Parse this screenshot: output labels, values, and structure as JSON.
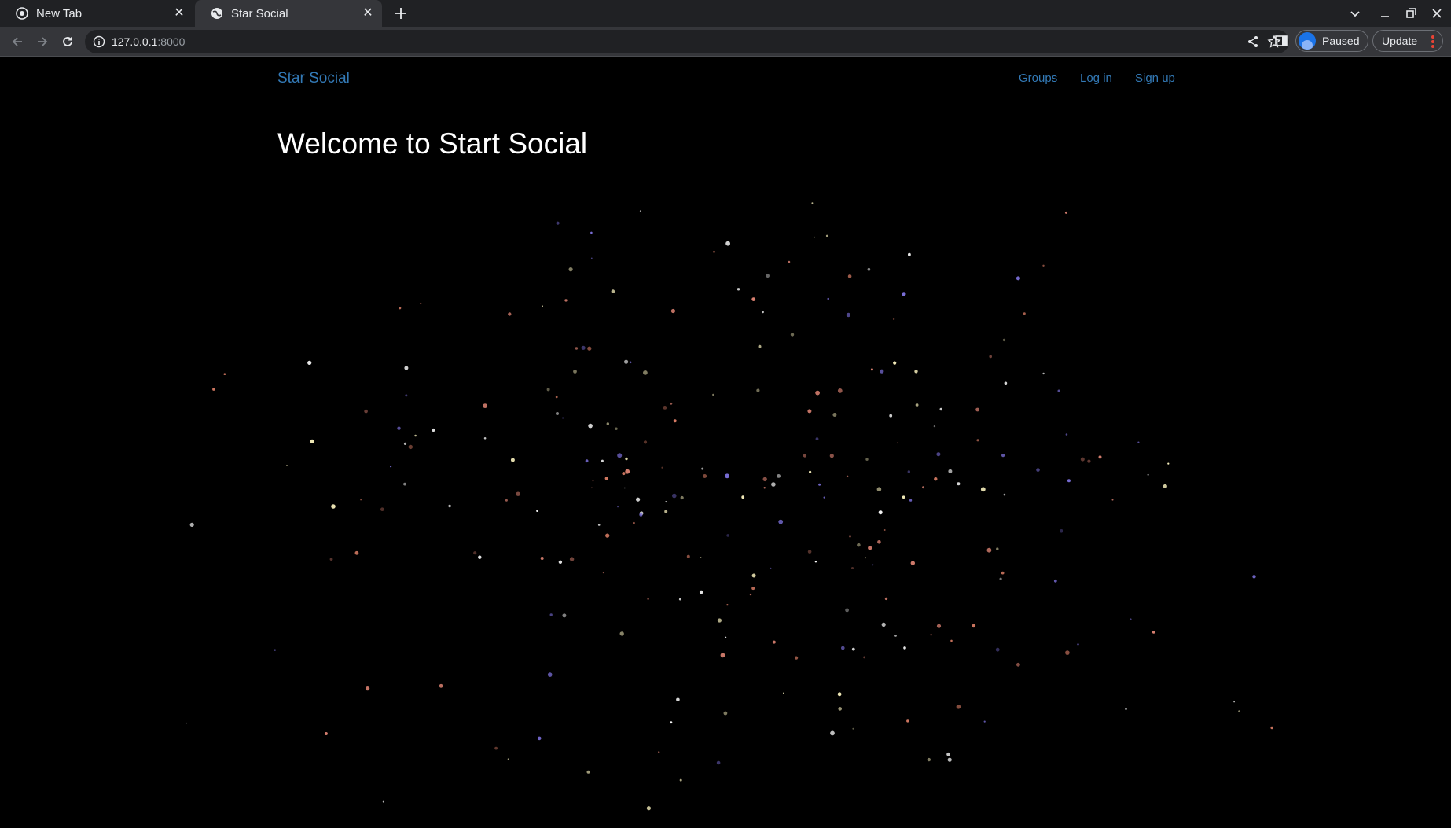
{
  "browser": {
    "tabs": [
      {
        "title": "New Tab",
        "active": false,
        "icon": "chrome-icon"
      },
      {
        "title": "Star Social",
        "active": true,
        "icon": "globe-icon"
      }
    ],
    "address": {
      "host": "127.0.0.1",
      "port": ":8000"
    },
    "profile_label": "Paused",
    "update_label": "Update"
  },
  "site": {
    "brand": "Star Social",
    "nav": [
      {
        "label": "Groups"
      },
      {
        "label": "Log in"
      },
      {
        "label": "Sign up"
      }
    ],
    "heading": "Welcome to Start Social"
  },
  "theme": {
    "accent": "#337ab7",
    "star_colors": [
      "#fff7c2",
      "#f08a70",
      "#7a6ed8",
      "#ffffff",
      "#d88070"
    ]
  }
}
